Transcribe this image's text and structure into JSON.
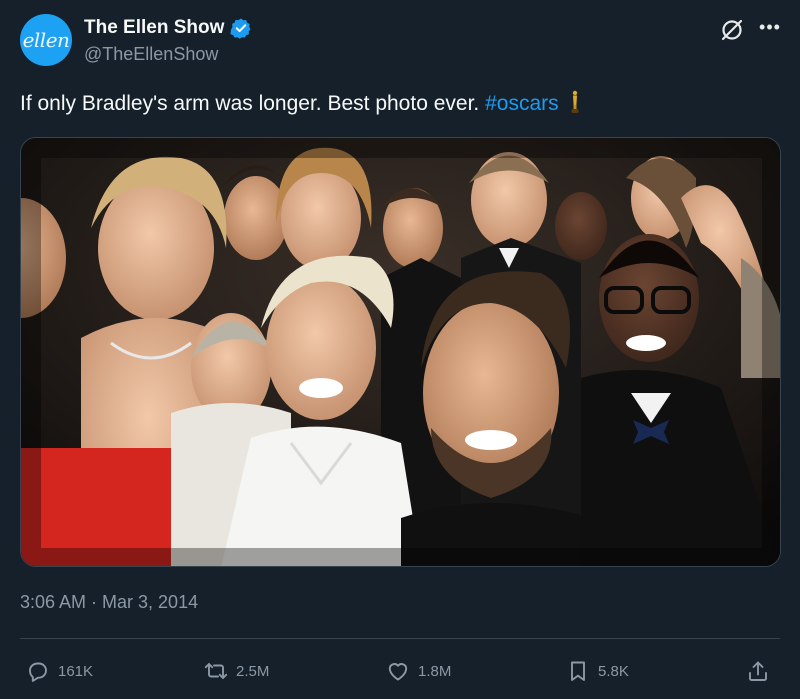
{
  "author": {
    "avatar_text": "ellen",
    "display_name": "The Ellen Show",
    "handle": "@TheEllenShow",
    "verified": true
  },
  "tweet": {
    "text": "If only Bradley's arm was longer. Best photo ever.",
    "hashtag": "#oscars",
    "timestamp": "3:06 AM · Mar 3, 2014"
  },
  "stats": {
    "replies": "161K",
    "retweets": "2.5M",
    "likes": "1.8M",
    "bookmarks": "5.8K"
  },
  "icons": {
    "verified": "verified-badge-icon",
    "grok": "grok-icon",
    "more": "more-icon",
    "oscar": "oscar-statuette-icon",
    "reply": "reply-icon",
    "retweet": "retweet-icon",
    "like": "heart-icon",
    "bookmark": "bookmark-icon",
    "share": "share-icon"
  },
  "colors": {
    "background": "#15202b",
    "accent": "#1d9bf0",
    "secondary_text": "#8b98a5",
    "avatar": "#1da1f2"
  }
}
